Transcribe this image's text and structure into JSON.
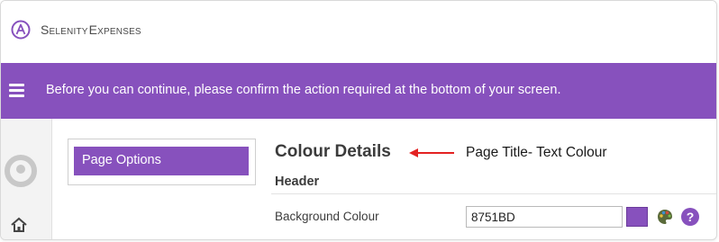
{
  "brand": {
    "part1": "Selenity",
    "part2": "Expenses",
    "logo_icon": "circle-a-logo-icon"
  },
  "banner": {
    "menu_icon": "hamburger-menu-icon",
    "message": "Before you can continue, please confirm the action required at the bottom of your screen."
  },
  "rail": {
    "avatar_icon": "user-avatar-icon",
    "home_icon": "home-icon"
  },
  "options": {
    "item_label": "Page Options"
  },
  "main": {
    "page_title": "Colour Details",
    "annotation": "Page Title- Text Colour",
    "section_header": "Header",
    "field_label": "Background Colour",
    "field_value": "8751BD",
    "swatch_color": "#8751BD",
    "palette_icon": "palette-icon",
    "help_icon": "help-icon",
    "help_glyph": "?"
  },
  "colors": {
    "accent": "#8751BD",
    "annotation_arrow": "#E32222"
  }
}
